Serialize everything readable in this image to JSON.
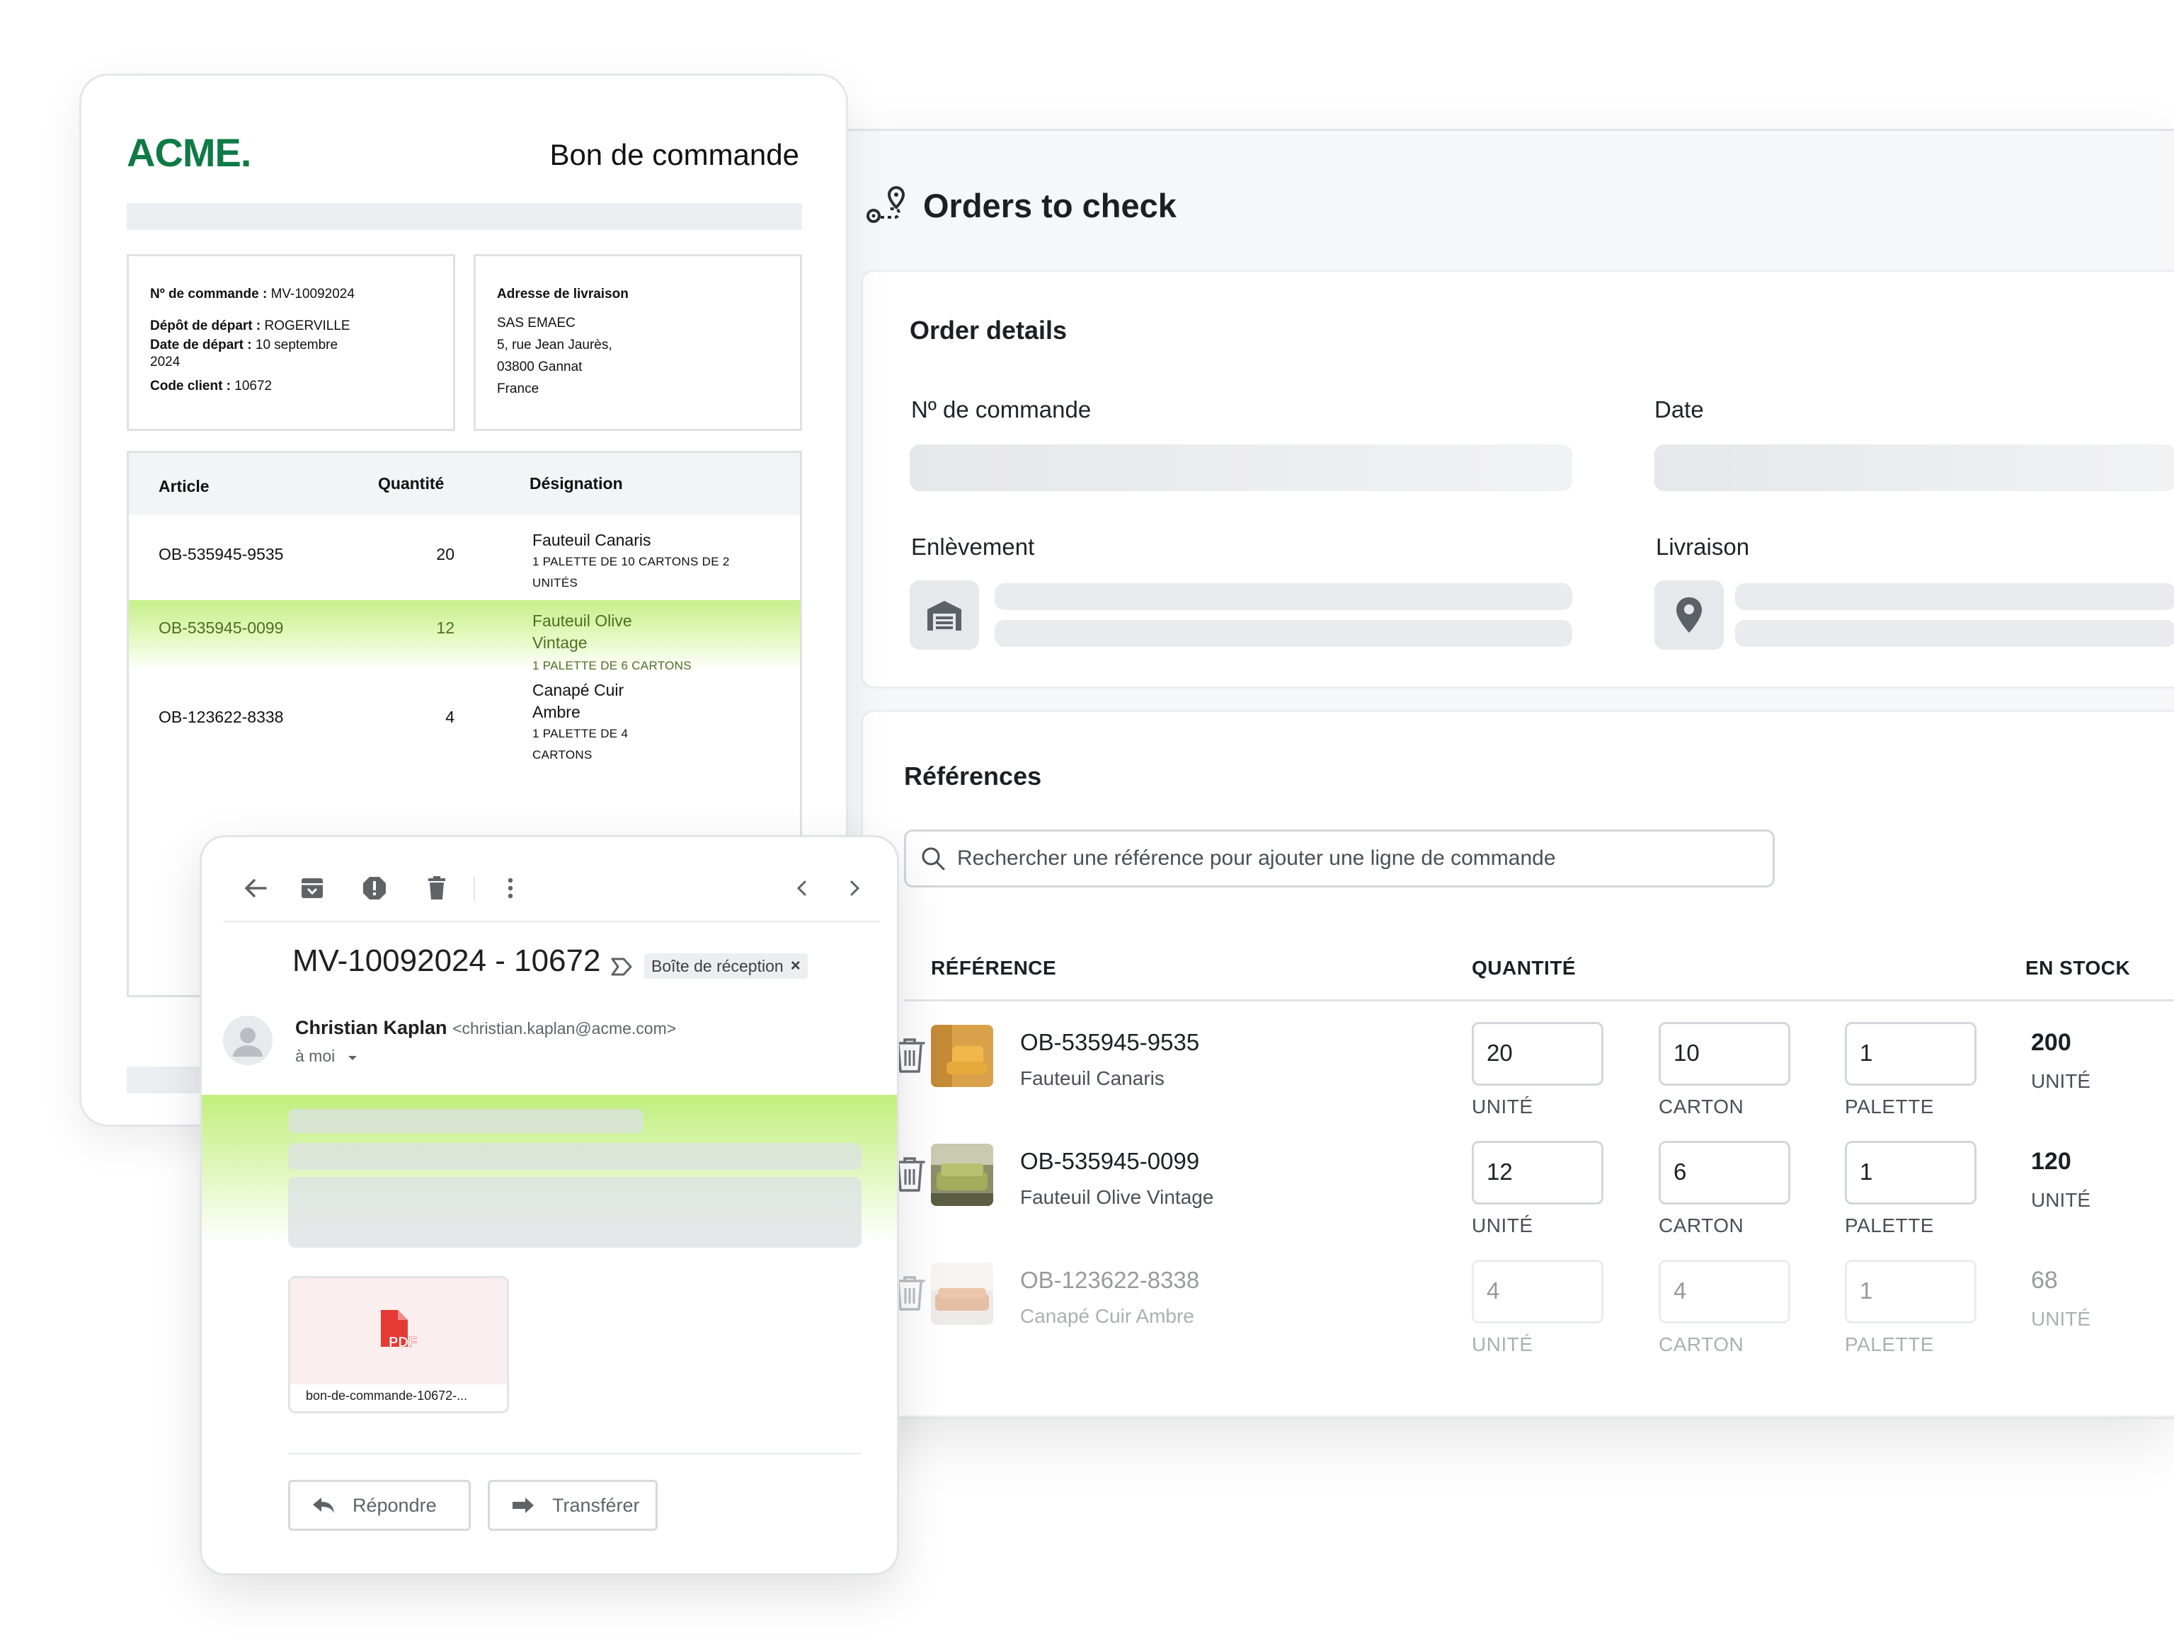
{
  "app": {
    "title": "Orders to check",
    "order_details": {
      "title": "Order details",
      "order_number_label": "Nº de commande",
      "date_label": "Date",
      "pickup_label": "Enlèvement",
      "delivery_label": "Livraison"
    },
    "references": {
      "title": "Références",
      "search_placeholder": "Rechercher une référence pour ajouter une ligne de commande",
      "columns": [
        "RÉFÉRENCE",
        "QUANTITÉ",
        "EN STOCK"
      ],
      "rows": [
        {
          "code": "OB-535945-9535",
          "name": "Fauteuil Canaris",
          "unite": "20",
          "carton": "10",
          "palette": "1",
          "stock": "200",
          "stock_unit": "UNITÉ"
        },
        {
          "code": "OB-535945-0099",
          "name": "Fauteuil Olive Vintage",
          "unite": "12",
          "carton": "6",
          "palette": "1",
          "stock": "120",
          "stock_unit": "UNITÉ"
        },
        {
          "code": "OB-123622-8338",
          "name": "Canapé Cuir Ambre",
          "unite": "4",
          "carton": "4",
          "palette": "1",
          "stock": "68",
          "stock_unit": "UNITÉ"
        }
      ],
      "unit_labels": {
        "unite": "UNITÉ",
        "carton": "CARTON",
        "palette": "PALETTE"
      }
    }
  },
  "doc": {
    "logo": "ACME.",
    "title": "Bon de commande",
    "left_box": {
      "order_label": "Nº de commande :",
      "order_value": " MV-10092024",
      "depot_label": "Dépôt de départ :",
      "depot_value": " ROGERVILLE",
      "date_label": "Date de départ :",
      "date_value": " 10 septembre 2024",
      "client_label": "Code client :",
      "client_value": " 10672"
    },
    "right_box": {
      "title": "Adresse de livraison",
      "line1": "SAS EMAEC",
      "line2": "5, rue Jean Jaurès,",
      "line3": "03800 Gannat",
      "line4": "France"
    },
    "table": {
      "headers": [
        "Article",
        "Quantité",
        "Désignation"
      ],
      "rows": [
        {
          "article": "OB-535945-9535",
          "qty": "20",
          "name": "Fauteuil Canaris",
          "detail": "1 PALETTE DE 10 CARTONS DE 2 UNITÉS"
        },
        {
          "article": "OB-535945-0099",
          "qty": "12",
          "name": "Fauteuil Olive Vintage",
          "detail": "1 PALETTE DE 6 CARTONS"
        },
        {
          "article": "OB-123622-8338",
          "qty": "4",
          "name": "Canapé Cuir Ambre",
          "detail": "1 PALETTE DE 4 CARTONS"
        }
      ]
    }
  },
  "email": {
    "subject": "MV-10092024 - 10672",
    "label": "Boîte de réception",
    "label_close": "×",
    "sender_name": "Christian Kaplan",
    "sender_email": "<christian.kaplan@acme.com>",
    "to": "à  moi",
    "attachment_name": "bon-de-commande-10672-...",
    "pdf_badge": "PDF",
    "reply_label": "Répondre",
    "forward_label": "Transférer"
  },
  "colors": {
    "brand": "#0f7a45",
    "highlight": "#c6f08a",
    "pdf_red": "#e53935"
  }
}
